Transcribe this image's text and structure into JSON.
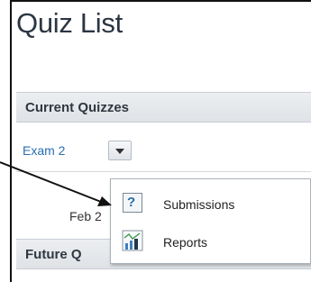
{
  "page": {
    "title": "Quiz List"
  },
  "sections": {
    "current_label": "Current Quizzes",
    "future_label": "Future Q"
  },
  "quiz": {
    "name": "Exam 2",
    "date_partial": "Feb 2"
  },
  "menu": {
    "items": [
      {
        "label": "Submissions",
        "icon": "question-help-icon"
      },
      {
        "label": "Reports",
        "icon": "bar-chart-icon"
      }
    ]
  },
  "colors": {
    "link": "#2a6fb0",
    "section_bg": "#e3e6ea",
    "title": "#2b3642"
  }
}
